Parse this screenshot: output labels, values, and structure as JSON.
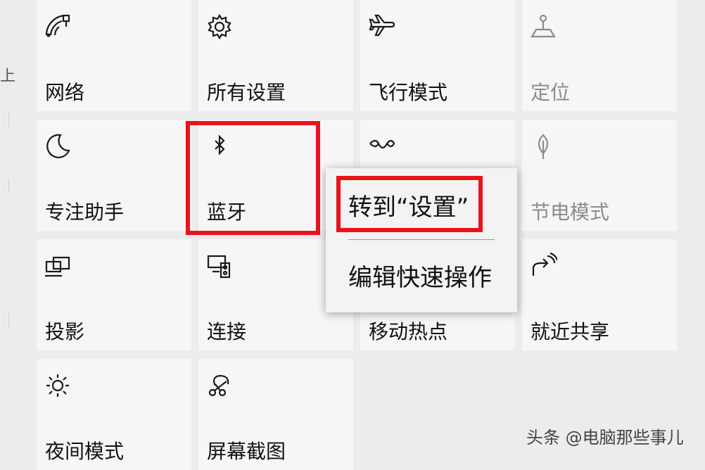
{
  "tiles": [
    {
      "label": "网络",
      "icon": "network-icon",
      "disabled": false
    },
    {
      "label": "所有设置",
      "icon": "gear-icon",
      "disabled": false
    },
    {
      "label": "飞行模式",
      "icon": "airplane-icon",
      "disabled": false
    },
    {
      "label": "定位",
      "icon": "location-icon",
      "disabled": true
    },
    {
      "label": "专注助手",
      "icon": "moon-icon",
      "disabled": false
    },
    {
      "label": "蓝牙",
      "icon": "bluetooth-icon",
      "disabled": false
    },
    {
      "label": "",
      "icon": "vpn-icon",
      "disabled": false
    },
    {
      "label": "节电模式",
      "icon": "leaf-icon",
      "disabled": true
    },
    {
      "label": "投影",
      "icon": "project-icon",
      "disabled": false
    },
    {
      "label": "连接",
      "icon": "connect-icon",
      "disabled": false
    },
    {
      "label": "移动热点",
      "icon": "hotspot-icon",
      "disabled": false
    },
    {
      "label": "就近共享",
      "icon": "share-icon",
      "disabled": false
    },
    {
      "label": "夜间模式",
      "icon": "brightness-icon",
      "disabled": false
    },
    {
      "label": "屏幕截图",
      "icon": "snip-icon",
      "disabled": false
    }
  ],
  "context_menu": {
    "items": [
      {
        "label": "转到“设置”"
      },
      {
        "label": "编辑快速操作"
      }
    ]
  },
  "left_edge": {
    "glyph": "上"
  },
  "watermark": "头条 @电脑那些事儿",
  "colors": {
    "highlight": "#e8141a",
    "tile": "#f6f6f6",
    "background": "#ececec",
    "disabled_text": "#8c8c8c"
  }
}
